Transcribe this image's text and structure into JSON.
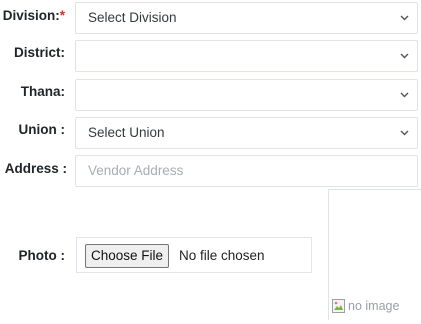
{
  "form": {
    "division": {
      "label": "Division:",
      "required_mark": "*",
      "value": "Select Division"
    },
    "district": {
      "label": "District:",
      "value": ""
    },
    "thana": {
      "label": "Thana:",
      "value": ""
    },
    "union": {
      "label": "Union :",
      "value": "Select Union"
    },
    "address": {
      "label": "Address :",
      "placeholder": "Vendor Address"
    },
    "photo": {
      "label": "Photo :",
      "button": "Choose File",
      "status": "No file chosen",
      "preview_alt": "no image"
    }
  },
  "icons": {
    "dropdown": "chevron-down-icon",
    "preview": "broken-image-icon"
  },
  "colors": {
    "required": "#d9302f",
    "border": "#dfe3e8",
    "placeholder": "#a7adb4"
  }
}
